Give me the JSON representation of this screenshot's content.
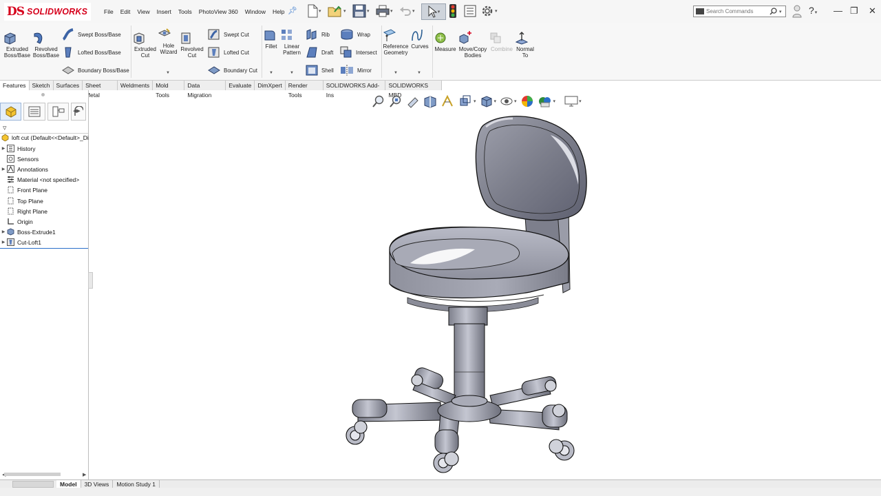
{
  "app": {
    "brand_mark": "DS",
    "brand_name": "SOLIDWORKS"
  },
  "menu": [
    "File",
    "Edit",
    "View",
    "Insert",
    "Tools",
    "PhotoView 360",
    "Window",
    "Help"
  ],
  "search": {
    "placeholder": "Search Commands"
  },
  "toolbar": {
    "extruded_boss": "Extruded\nBoss/Base",
    "revolved_boss": "Revolved\nBoss/Base",
    "swept_boss": "Swept Boss/Base",
    "lofted_boss": "Lofted Boss/Base",
    "boundary_boss": "Boundary Boss/Base",
    "extruded_cut": "Extruded\nCut",
    "hole_wizard": "Hole\nWizard",
    "revolved_cut": "Revolved\nCut",
    "swept_cut": "Swept Cut",
    "lofted_cut": "Lofted Cut",
    "boundary_cut": "Boundary Cut",
    "fillet": "Fillet",
    "linear_pattern": "Linear\nPattern",
    "rib": "Rib",
    "draft": "Draft",
    "shell": "Shell",
    "wrap": "Wrap",
    "intersect": "Intersect",
    "mirror": "Mirror",
    "reference_geometry": "Reference\nGeometry",
    "curves": "Curves",
    "measure": "Measure",
    "move_copy": "Move/Copy\nBodies",
    "combine": "Combine",
    "normal_to": "Normal\nTo"
  },
  "tabs": [
    "Features",
    "Sketch",
    "Surfaces",
    "Sheet Metal",
    "Weldments",
    "Mold Tools",
    "Data Migration",
    "Evaluate",
    "DimXpert",
    "Render Tools",
    "SOLIDWORKS Add-Ins",
    "SOLIDWORKS MBD"
  ],
  "tree": {
    "root": "loft cut  (Default<<Default>_Di",
    "items": [
      "History",
      "Sensors",
      "Annotations",
      "Material <not specified>",
      "Front Plane",
      "Top Plane",
      "Right Plane",
      "Origin",
      "Boss-Extrude1",
      "Cut-Loft1"
    ]
  },
  "bottom_tabs": [
    "Model",
    "3D Views",
    "Motion Study 1"
  ],
  "colors": {
    "accent": "#2a6fc9",
    "brand": "#d6001c",
    "model": "#9c9eab"
  }
}
